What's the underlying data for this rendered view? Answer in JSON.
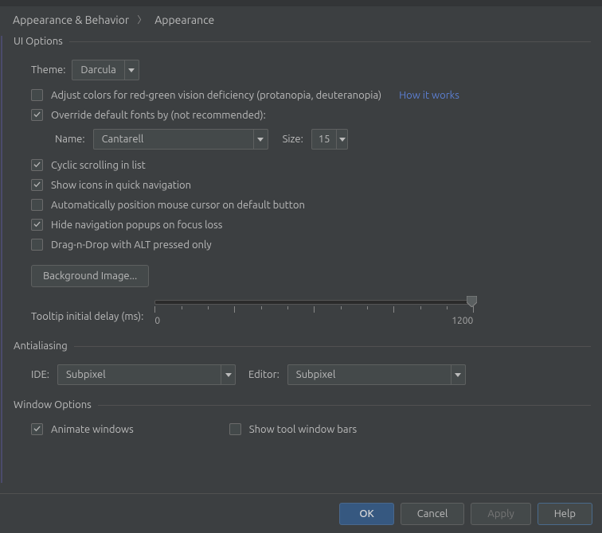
{
  "breadcrumb": {
    "parent": "Appearance & Behavior",
    "current": "Appearance"
  },
  "sections": {
    "ui": {
      "title": "UI Options",
      "theme_label": "Theme:",
      "theme_value": "Darcula",
      "adjust_colors": "Adjust colors for red-green vision deficiency (protanopia, deuteranopia)",
      "how_it_works": "How it works",
      "override_fonts": "Override default fonts by (not recommended):",
      "font_name_label": "Name:",
      "font_name_value": "Cantarell",
      "font_size_label": "Size:",
      "font_size_value": "15",
      "cyclic": "Cyclic scrolling in list",
      "show_icons": "Show icons in quick navigation",
      "auto_mouse": "Automatically position mouse cursor on default button",
      "hide_popups": "Hide navigation popups on focus loss",
      "drag_alt": "Drag-n-Drop with ALT pressed only",
      "bg_image": "Background Image...",
      "tooltip_label": "Tooltip initial delay (ms):",
      "slider_min": "0",
      "slider_max": "1200"
    },
    "aa": {
      "title": "Antialiasing",
      "ide_label": "IDE:",
      "ide_value": "Subpixel",
      "editor_label": "Editor:",
      "editor_value": "Subpixel"
    },
    "win": {
      "title": "Window Options",
      "animate": "Animate windows",
      "show_tool": "Show tool window bars"
    }
  },
  "footer": {
    "ok": "OK",
    "cancel": "Cancel",
    "apply": "Apply",
    "help": "Help"
  }
}
